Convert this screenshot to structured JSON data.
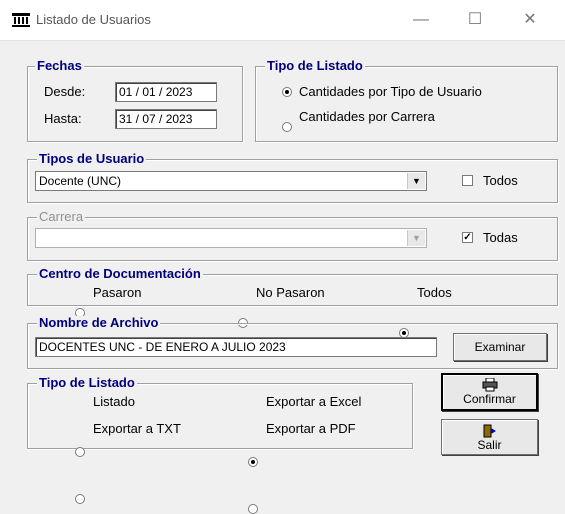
{
  "window": {
    "title": "Listado de Usuarios",
    "minimize": "—",
    "maximize": "☐",
    "close": "✕"
  },
  "fechas": {
    "legend": "Fechas",
    "desde_label": "Desde:",
    "desde_value": "01 / 01 / 2023",
    "hasta_label": "Hasta:",
    "hasta_value": "31 / 07 / 2023"
  },
  "tipo_listado_top": {
    "legend": "Tipo de Listado",
    "options": [
      {
        "label": "Cantidades por Tipo de Usuario",
        "selected": true
      },
      {
        "label": "Cantidades por Carrera",
        "selected": false
      }
    ]
  },
  "tipos_usuario": {
    "legend": "Tipos de Usuario",
    "selected_value": "Docente (UNC)",
    "todos_label": "Todos",
    "todos_checked": false
  },
  "carrera": {
    "legend": "Carrera",
    "selected_value": "",
    "todas_label": "Todas",
    "todas_checked": true,
    "disabled": true
  },
  "centro": {
    "legend": "Centro de Documentación",
    "options": [
      {
        "label": "Pasaron",
        "selected": false
      },
      {
        "label": "No Pasaron",
        "selected": false
      },
      {
        "label": "Todos",
        "selected": true
      }
    ]
  },
  "archivo": {
    "legend": "Nombre de Archivo",
    "value": "DOCENTES UNC - DE ENERO A JULIO 2023",
    "browse_label": "Examinar"
  },
  "tipo_listado_bottom": {
    "legend": "Tipo de Listado",
    "options": [
      {
        "label": "Listado",
        "selected": false
      },
      {
        "label": "Exportar a Excel",
        "selected": true
      },
      {
        "label": "Exportar a TXT",
        "selected": false
      },
      {
        "label": "Exportar a PDF",
        "selected": false
      }
    ]
  },
  "buttons": {
    "confirm_label": "Confirmar",
    "exit_label": "Salir"
  },
  "icons": {
    "app": "library-building-icon",
    "confirm": "printer-icon",
    "exit": "exit-door-icon"
  }
}
